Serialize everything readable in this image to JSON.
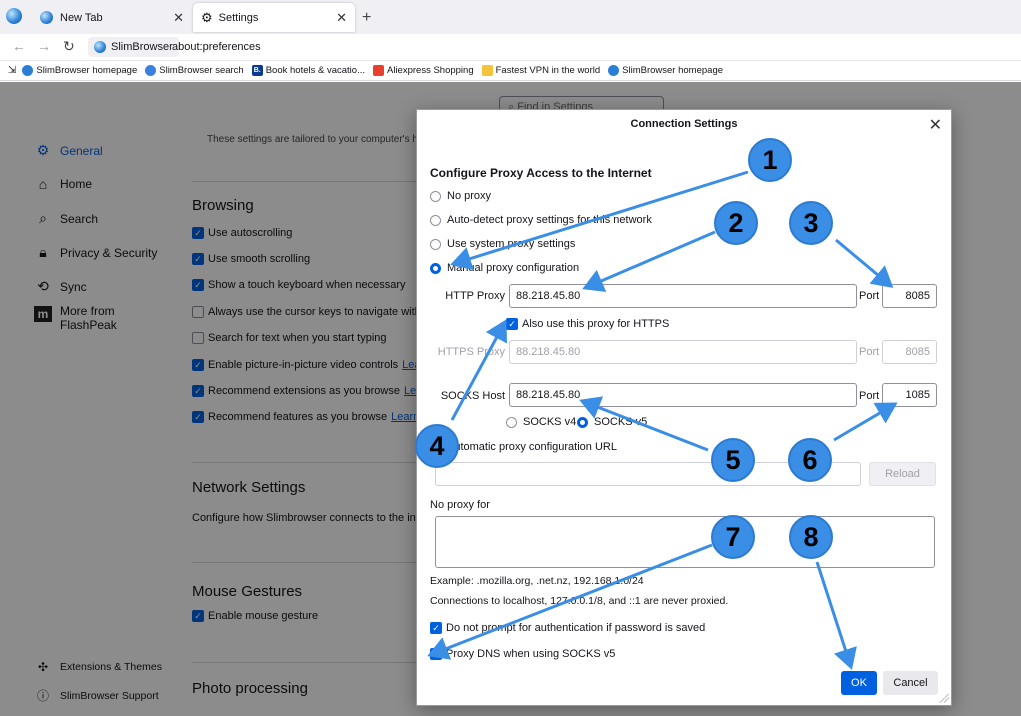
{
  "tabs": [
    {
      "label": "New Tab",
      "icon": "globe-icon"
    },
    {
      "label": "Settings",
      "icon": "gear-icon"
    }
  ],
  "nav": {
    "site_label": "SlimBrowser",
    "url": "about:preferences"
  },
  "bookmarks": [
    {
      "label": "SlimBrowser homepage",
      "color": "#2a7fd4"
    },
    {
      "label": "SlimBrowser search",
      "color": "#3b7fe0"
    },
    {
      "label": "Book hotels & vacatio...",
      "color": "#0b3b8c",
      "glyph": "B."
    },
    {
      "label": "Aliexpress Shopping",
      "color": "#e8402c"
    },
    {
      "label": "Fastest VPN in the world",
      "color": "#f5c23a"
    },
    {
      "label": "SlimBrowser homepage",
      "color": "#2a7fd4"
    }
  ],
  "prefs": {
    "search_placeholder": "Find in Settings",
    "tailored_text": "These settings are tailored to your computer's h",
    "sidebar": [
      {
        "label": "General",
        "icon": "gear-icon"
      },
      {
        "label": "Home",
        "icon": "home-icon"
      },
      {
        "label": "Search",
        "icon": "search-icon"
      },
      {
        "label": "Privacy & Security",
        "icon": "lock-icon"
      },
      {
        "label": "Sync",
        "icon": "sync-icon"
      },
      {
        "label": "More from",
        "label2": "FlashPeak",
        "icon": "flashpeak-icon"
      }
    ],
    "sidebar_footer": [
      {
        "label": "Extensions & Themes",
        "icon": "puzzle-icon"
      },
      {
        "label": "SlimBrowser Support",
        "icon": "help-icon"
      }
    ],
    "browsing": {
      "title": "Browsing",
      "items": [
        {
          "label": "Use autoscrolling",
          "checked": true
        },
        {
          "label": "Use smooth scrolling",
          "checked": true
        },
        {
          "label": "Show a touch keyboard when necessary",
          "checked": true
        },
        {
          "label": "Always use the cursor keys to navigate within",
          "checked": false
        },
        {
          "label": "Search for text when you start typing",
          "checked": false
        },
        {
          "label": "Enable picture-in-picture video controls",
          "checked": true,
          "link": "Lea"
        },
        {
          "label": "Recommend extensions as you browse",
          "checked": true,
          "link": "Lear"
        },
        {
          "label": "Recommend features as you browse",
          "checked": true,
          "link": "Learn r"
        }
      ]
    },
    "network": {
      "title": "Network Settings",
      "desc": "Configure how Slimbrowser connects to the inte"
    },
    "mouse": {
      "title": "Mouse Gestures",
      "item": "Enable mouse gesture"
    },
    "photo": {
      "title": "Photo processing"
    }
  },
  "dialog": {
    "title": "Connection Settings",
    "heading": "Configure Proxy Access to the Internet",
    "options": [
      {
        "label": "No proxy",
        "selected": false
      },
      {
        "label": "Auto-detect proxy settings for this network",
        "selected": false
      },
      {
        "label": "Use system proxy settings",
        "selected": false
      },
      {
        "label": "Manual proxy configuration",
        "selected": true
      }
    ],
    "http_proxy_label": "HTTP Proxy",
    "http_proxy": "88.218.45.80",
    "http_port_label": "Port",
    "http_port": "8085",
    "also_https_label": "Also use this proxy for HTTPS",
    "https_proxy_label": "HTTPS Proxy",
    "https_proxy": "88.218.45.80",
    "https_port_label": "Port",
    "https_port": "8085",
    "socks_label": "SOCKS Host",
    "socks_host": "88.218.45.80",
    "socks_port_label": "Port",
    "socks_port": "1085",
    "socks_v4": "SOCKS v4",
    "socks_v5": "SOCKS v5",
    "auto_url_label": "Automatic proxy configuration URL",
    "reload_label": "Reload",
    "no_proxy_label": "No proxy for",
    "example_text": "Example: .mozilla.org, .net.nz, 192.168.1.0/24",
    "localhost_text": "Connections to localhost, 127.0.0.1/8, and ::1 are never proxied.",
    "no_prompt_label": "Do not prompt for authentication if password is saved",
    "proxy_dns_label": "Proxy DNS when using SOCKS v5",
    "ok_label": "OK",
    "cancel_label": "Cancel"
  },
  "callouts": [
    "1",
    "2",
    "3",
    "4",
    "5",
    "6",
    "7",
    "8"
  ],
  "colors": {
    "accent": "#0061e0",
    "callout": "#3a8ee6"
  }
}
